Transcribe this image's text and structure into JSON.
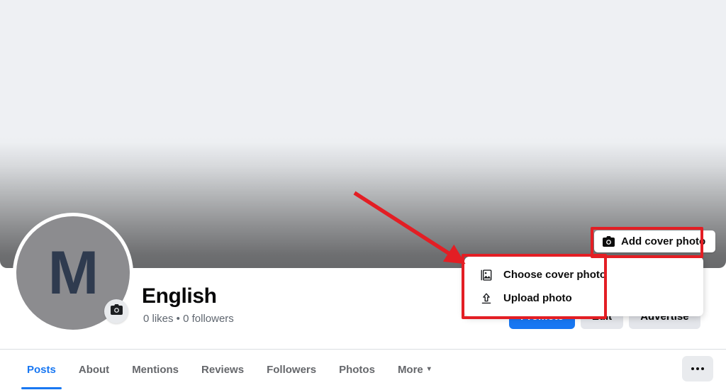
{
  "cover": {
    "add_cover_label": "Add cover photo",
    "add_cover_icon": "camera-icon",
    "gradient_top": "#eef0f3",
    "gradient_bottom": "#68696b"
  },
  "dropdown": {
    "items": [
      {
        "label": "Choose cover photo",
        "icon": "photo-stack-icon"
      },
      {
        "label": "Upload photo",
        "icon": "upload-arrow-icon"
      }
    ]
  },
  "annotation": {
    "color": "#e31e24",
    "arrow": "red-arrow"
  },
  "profile": {
    "avatar_letter": "M",
    "avatar_bg": "#8c8c8f",
    "avatar_letter_color": "#2f3b4f",
    "camera_icon": "camera-icon",
    "name": "English",
    "stats": "0 likes • 0 followers"
  },
  "actions": [
    {
      "label": "Promote",
      "style": "primary"
    },
    {
      "label": "Edit",
      "style": "secondary"
    },
    {
      "label": "Advertise",
      "style": "secondary"
    }
  ],
  "tabs": [
    {
      "label": "Posts",
      "active": true
    },
    {
      "label": "About",
      "active": false
    },
    {
      "label": "Mentions",
      "active": false
    },
    {
      "label": "Reviews",
      "active": false
    },
    {
      "label": "Followers",
      "active": false
    },
    {
      "label": "Photos",
      "active": false
    },
    {
      "label": "More",
      "active": false,
      "caret": "▾"
    }
  ],
  "more_options": {
    "icon": "ellipsis-icon"
  },
  "colors": {
    "accent": "#1877f2",
    "annotation_red": "#e31e24",
    "text_primary": "#050505",
    "text_secondary": "#65676b"
  }
}
